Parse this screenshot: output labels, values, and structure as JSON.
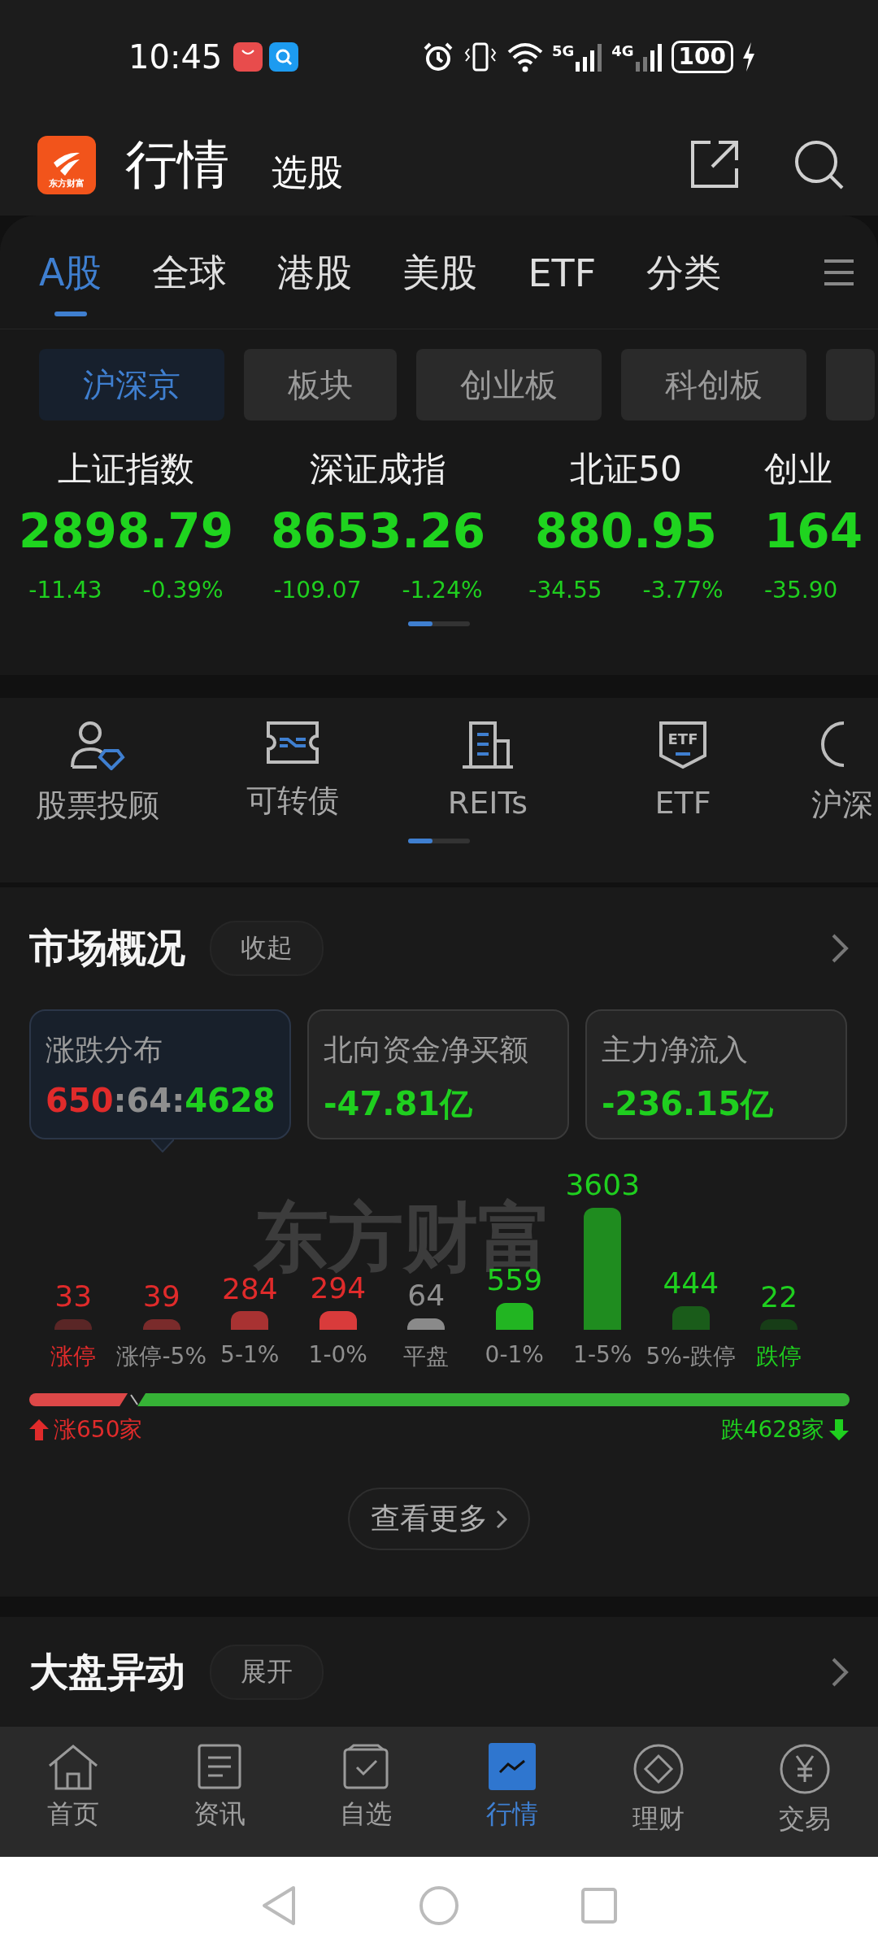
{
  "status_bar": {
    "time": "10:45",
    "network_1": "5G",
    "network_2": "4G",
    "battery": "100"
  },
  "header": {
    "logo_text": "东方财富",
    "title": "行情",
    "subtitle": "选股"
  },
  "tabs": [
    {
      "label": "A股",
      "selected": true
    },
    {
      "label": "全球",
      "selected": false
    },
    {
      "label": "港股",
      "selected": false
    },
    {
      "label": "美股",
      "selected": false
    },
    {
      "label": "ETF",
      "selected": false
    },
    {
      "label": "分类",
      "selected": false
    }
  ],
  "chips": [
    {
      "label": "沪深京",
      "selected": true
    },
    {
      "label": "板块",
      "selected": false
    },
    {
      "label": "创业板",
      "selected": false
    },
    {
      "label": "科创板",
      "selected": false
    }
  ],
  "indices": [
    {
      "name": "上证指数",
      "value": "2898.79",
      "change": "-11.43",
      "percent": "-0.39%"
    },
    {
      "name": "深证成指",
      "value": "8653.26",
      "change": "-109.07",
      "percent": "-1.24%"
    },
    {
      "name": "北证50",
      "value": "880.95",
      "change": "-34.55",
      "percent": "-3.77%"
    },
    {
      "name": "创业",
      "value": "164",
      "change": "-35.90"
    }
  ],
  "shortcuts": [
    {
      "label": "股票投顾",
      "kind": "advisor"
    },
    {
      "label": "可转债",
      "kind": "bond"
    },
    {
      "label": "REITs",
      "kind": "reits"
    },
    {
      "label": "ETF",
      "kind": "etf",
      "badge": "ETF"
    },
    {
      "label": "沪深",
      "kind": "connect"
    }
  ],
  "market_overview": {
    "title": "市场概况",
    "toggle": "收起",
    "stats": [
      {
        "title": "涨跌分布",
        "selected": true,
        "value_parts": [
          {
            "text": "650",
            "kind": "up"
          },
          {
            "text": ":",
            "kind": "flat"
          },
          {
            "text": "64",
            "kind": "flat"
          },
          {
            "text": ":",
            "kind": "flat"
          },
          {
            "text": "4628",
            "kind": "down"
          }
        ]
      },
      {
        "title": "北向资金净买额",
        "selected": false,
        "value_parts": [
          {
            "text": "-47.81亿",
            "kind": "down"
          }
        ]
      },
      {
        "title": "主力净流入",
        "selected": false,
        "value_parts": [
          {
            "text": "-236.15亿",
            "kind": "down"
          }
        ]
      }
    ],
    "watermark": "东方财富",
    "distribution": [
      {
        "count": "33",
        "label": "涨停",
        "kind": "up",
        "label_highlight": true,
        "color": "#5a2626"
      },
      {
        "count": "39",
        "label": "涨停-5%",
        "kind": "up",
        "label_highlight": false,
        "color": "#7a2b2b"
      },
      {
        "count": "284",
        "label": "5-1%",
        "kind": "up",
        "label_highlight": false,
        "color": "#a83232"
      },
      {
        "count": "294",
        "label": "1-0%",
        "kind": "up",
        "label_highlight": false,
        "color": "#d93b3b"
      },
      {
        "count": "64",
        "label": "平盘",
        "kind": "flat",
        "label_highlight": false,
        "color": "#8a8a8a"
      },
      {
        "count": "559",
        "label": "0-1%",
        "kind": "down",
        "label_highlight": false,
        "color": "#22b522"
      },
      {
        "count": "3603",
        "label": "1-5%",
        "kind": "down",
        "label_highlight": false,
        "color": "#1f8c1f"
      },
      {
        "count": "444",
        "label": "5%-跌停",
        "kind": "down",
        "label_highlight": false,
        "color": "#1a5c1a"
      },
      {
        "count": "22",
        "label": "跌停",
        "kind": "down",
        "label_highlight": true,
        "color": "#173d17"
      }
    ],
    "ratio_bar": {
      "level": 0.12
    },
    "rise_label": "涨650家",
    "fall_label": "跌4628家",
    "more_button": "查看更多"
  },
  "market_moves": {
    "title": "大盘异动",
    "toggle": "展开"
  },
  "bottom_nav": [
    {
      "label": "首页",
      "kind": "home",
      "selected": false
    },
    {
      "label": "资讯",
      "kind": "news",
      "selected": false
    },
    {
      "label": "自选",
      "kind": "watchlist",
      "selected": false
    },
    {
      "label": "行情",
      "kind": "market",
      "selected": true
    },
    {
      "label": "理财",
      "kind": "wealth",
      "selected": false
    },
    {
      "label": "交易",
      "kind": "trade",
      "selected": false
    }
  ]
}
